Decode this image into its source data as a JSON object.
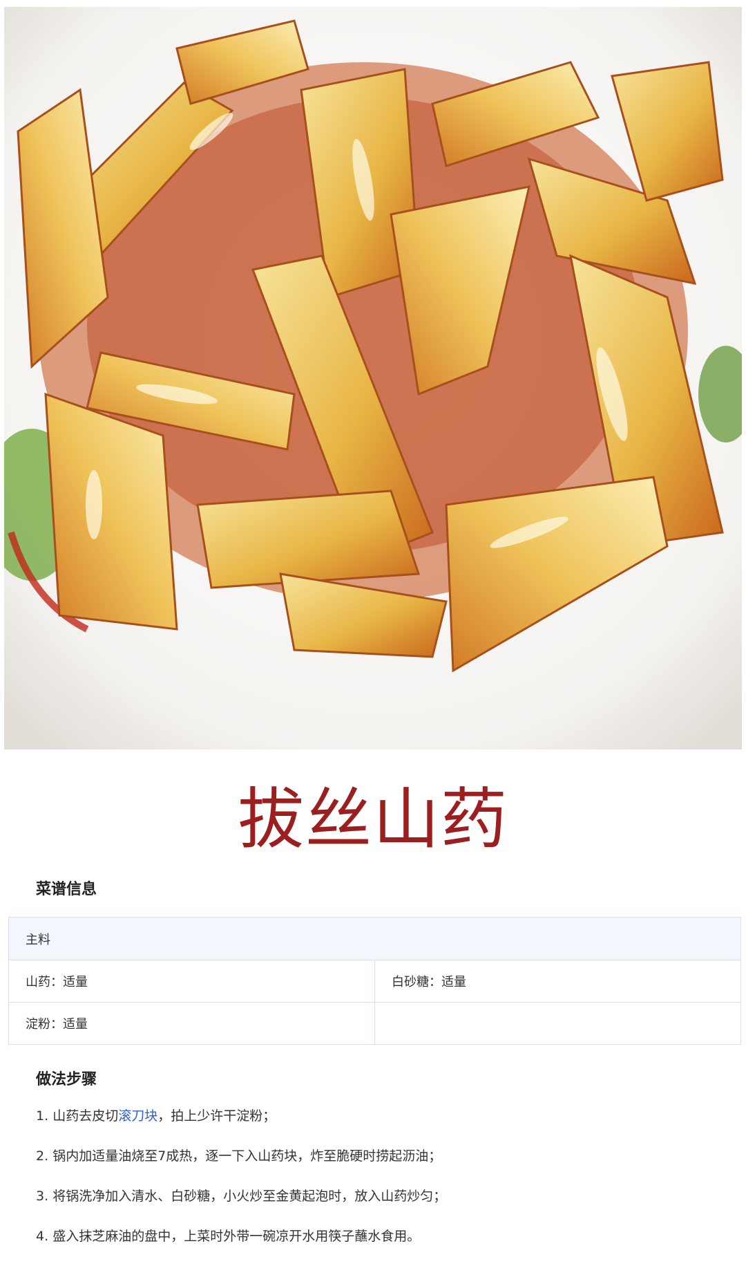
{
  "title": "拔丝山药",
  "recipe_info": {
    "heading": "菜谱信息",
    "table_header": "主料",
    "rows": [
      [
        "山药：适量",
        "白砂糖：适量"
      ],
      [
        "淀粉：适量",
        ""
      ]
    ]
  },
  "steps_section": {
    "heading": "做法步骤",
    "steps": [
      {
        "num": "1.",
        "before": "山药去皮切",
        "link": "滚刀块",
        "after": "，拍上少许干淀粉；"
      },
      {
        "num": "2.",
        "text": "锅内加适量油烧至7成热，逐一下入山药块，炸至脆硬时捞起沥油；"
      },
      {
        "num": "3.",
        "text": "将锅洗净加入清水、白砂糖，小火炒至金黄起泡时，放入山药炒匀；"
      },
      {
        "num": "4.",
        "text": "盛入抹芝麻油的盘中，上菜时外带一碗凉开水用筷子蘸水食用。"
      }
    ]
  },
  "colors": {
    "title": "#9b1f1f",
    "link": "#2f5fd0",
    "table_header_bg": "#f2f6fd",
    "table_border": "#d9dfea"
  }
}
